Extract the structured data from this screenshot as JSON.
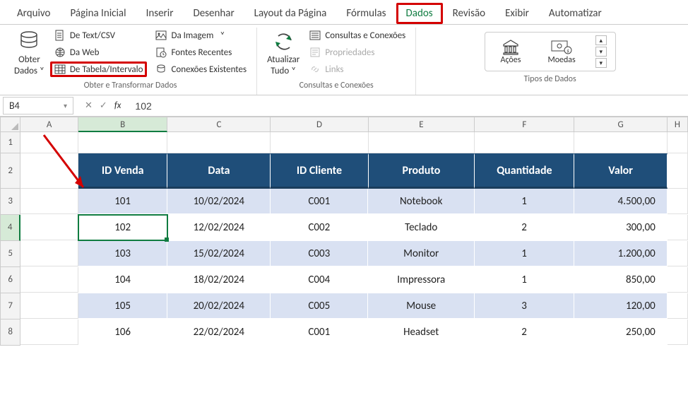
{
  "menu": {
    "items": [
      "Arquivo",
      "Página Inicial",
      "Inserir",
      "Desenhar",
      "Layout da Página",
      "Fórmulas",
      "Dados",
      "Revisão",
      "Exibir",
      "Automatizar"
    ],
    "active": "Dados"
  },
  "ribbon": {
    "get_data": {
      "label": "Obter\nDados"
    },
    "text_csv": "De Text/CSV",
    "web": "Da Web",
    "table_range": "De Tabela/Intervalo",
    "image": "Da Imagem",
    "recent": "Fontes Recentes",
    "existing": "Conexões Existentes",
    "group1_label": "Obter e Transformar Dados",
    "refresh": "Atualizar\nTudo",
    "queries": "Consultas e Conexões",
    "properties": "Propriedades",
    "links": "Links",
    "group2_label": "Consultas e Conexões",
    "stocks": "Ações",
    "currency": "Moedas",
    "group3_label": "Tipos de Dados"
  },
  "formula_bar": {
    "name_box": "B4",
    "value": "102"
  },
  "sheet": {
    "cols": [
      "A",
      "B",
      "C",
      "D",
      "E",
      "F",
      "G",
      "H"
    ],
    "selected_col": "B",
    "selected_row": 4,
    "headers": [
      "ID Venda",
      "Data",
      "ID Cliente",
      "Produto",
      "Quantidade",
      "Valor"
    ],
    "rows": [
      {
        "id": "101",
        "data": "10/02/2024",
        "cli": "C001",
        "prod": "Notebook",
        "qtd": "1",
        "val": "4.500,00"
      },
      {
        "id": "102",
        "data": "12/02/2024",
        "cli": "C002",
        "prod": "Teclado",
        "qtd": "2",
        "val": "300,00"
      },
      {
        "id": "103",
        "data": "15/02/2024",
        "cli": "C003",
        "prod": "Monitor",
        "qtd": "1",
        "val": "1.200,00"
      },
      {
        "id": "104",
        "data": "18/02/2024",
        "cli": "C004",
        "prod": "Impressora",
        "qtd": "1",
        "val": "850,00"
      },
      {
        "id": "105",
        "data": "20/02/2024",
        "cli": "C005",
        "prod": "Mouse",
        "qtd": "3",
        "val": "120,00"
      },
      {
        "id": "106",
        "data": "22/02/2024",
        "cli": "C001",
        "prod": "Headset",
        "qtd": "2",
        "val": "250,00"
      }
    ]
  }
}
